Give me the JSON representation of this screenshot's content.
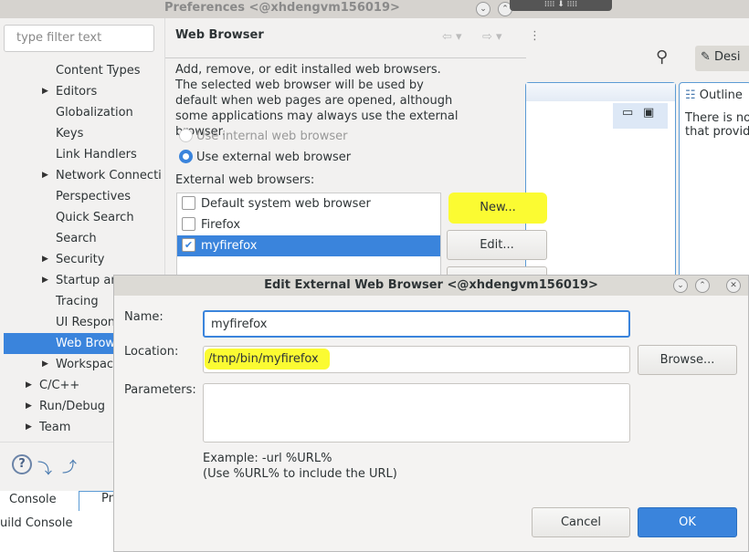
{
  "window": {
    "title": "Preferences  <@xhdengvm156019>"
  },
  "filter": {
    "placeholder": "type filter text"
  },
  "tree": [
    {
      "label": "Content Types",
      "arrow": false,
      "level": 2
    },
    {
      "label": "Editors",
      "arrow": true,
      "level": 2
    },
    {
      "label": "Globalization",
      "arrow": false,
      "level": 2
    },
    {
      "label": "Keys",
      "arrow": false,
      "level": 2
    },
    {
      "label": "Link Handlers",
      "arrow": false,
      "level": 2
    },
    {
      "label": "Network Connecti",
      "arrow": true,
      "level": 2
    },
    {
      "label": "Perspectives",
      "arrow": false,
      "level": 2
    },
    {
      "label": "Quick Search",
      "arrow": false,
      "level": 2
    },
    {
      "label": "Search",
      "arrow": false,
      "level": 2
    },
    {
      "label": "Security",
      "arrow": true,
      "level": 2
    },
    {
      "label": "Startup and",
      "arrow": true,
      "level": 2
    },
    {
      "label": "Tracing",
      "arrow": false,
      "level": 2
    },
    {
      "label": "UI Respon",
      "arrow": false,
      "level": 2
    },
    {
      "label": "Web Brows",
      "arrow": false,
      "level": 2,
      "selected": true
    },
    {
      "label": "Workspac",
      "arrow": true,
      "level": 2
    },
    {
      "label": "C/C++",
      "arrow": true,
      "level": 1
    },
    {
      "label": "Run/Debug",
      "arrow": true,
      "level": 1
    },
    {
      "label": "Team",
      "arrow": true,
      "level": 1
    }
  ],
  "page": {
    "title": "Web Browser",
    "desc1": "Add, remove, or edit installed web browsers.",
    "desc2": "The selected web browser will be used by default when web pages are opened, although some applications may always use the external browser.",
    "radio_internal": "Use internal web browser",
    "radio_external": "Use external web browser",
    "list_label": "External web browsers:",
    "browsers": [
      {
        "label": "Default system web browser",
        "checked": false
      },
      {
        "label": "Firefox",
        "checked": false
      },
      {
        "label": "myfirefox",
        "checked": true
      }
    ],
    "new_button": "New...",
    "edit_button": "Edit..."
  },
  "background": {
    "outline_title": "Outline",
    "outline_text1": "There is no",
    "outline_text2": "that provid",
    "design_tab": "Desi",
    "console_tab": "Console",
    "console_tab2": "Pr",
    "build_console": "uild Console"
  },
  "dialog": {
    "title": "Edit External Web Browser  <@xhdengvm156019>",
    "name_label": "Name:",
    "name_value": "myfirefox",
    "location_label": "Location:",
    "location_value": "/tmp/bin/myfirefox",
    "parameters_label": "Parameters:",
    "parameters_value": "",
    "browse_button": "Browse...",
    "example1": "Example: -url %URL%",
    "example2": "(Use %URL% to include the URL)",
    "cancel_button": "Cancel",
    "ok_button": "OK"
  },
  "colors": {
    "accent": "#3a84dc",
    "highlight": "#fbfb32"
  }
}
